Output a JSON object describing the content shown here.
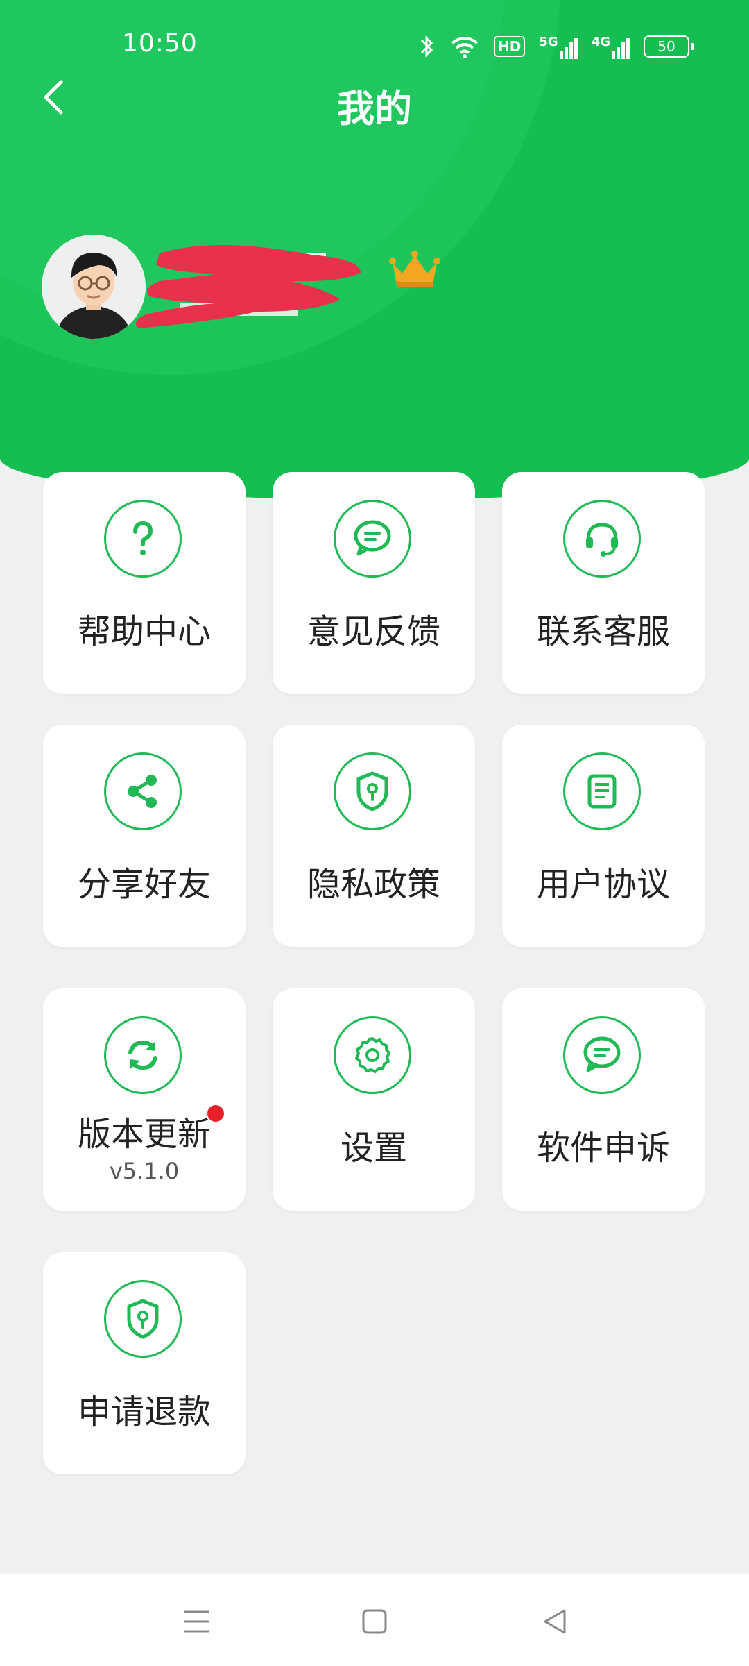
{
  "status_bar": {
    "time": "10:50",
    "battery": "50",
    "signal_labels": [
      "5G",
      "4G"
    ],
    "hd_label": "HD"
  },
  "header": {
    "title": "我的"
  },
  "menu": {
    "items": [
      {
        "label": "帮助中心",
        "icon": "help-icon"
      },
      {
        "label": "意见反馈",
        "icon": "feedback-icon"
      },
      {
        "label": "联系客服",
        "icon": "headset-icon"
      },
      {
        "label": "分享好友",
        "icon": "share-icon"
      },
      {
        "label": "隐私政策",
        "icon": "shield-icon"
      },
      {
        "label": "用户协议",
        "icon": "document-icon"
      },
      {
        "label": "版本更新",
        "icon": "refresh-icon",
        "sub": "v5.1.0",
        "badge": true
      },
      {
        "label": "设置",
        "icon": "gear-icon"
      },
      {
        "label": "软件申诉",
        "icon": "chat-icon"
      },
      {
        "label": "申请退款",
        "icon": "shield-icon"
      }
    ]
  },
  "colors": {
    "primary": "#16be52",
    "accent": "#1fb955",
    "badge": "#e8202a",
    "crown": "#f5a623"
  }
}
